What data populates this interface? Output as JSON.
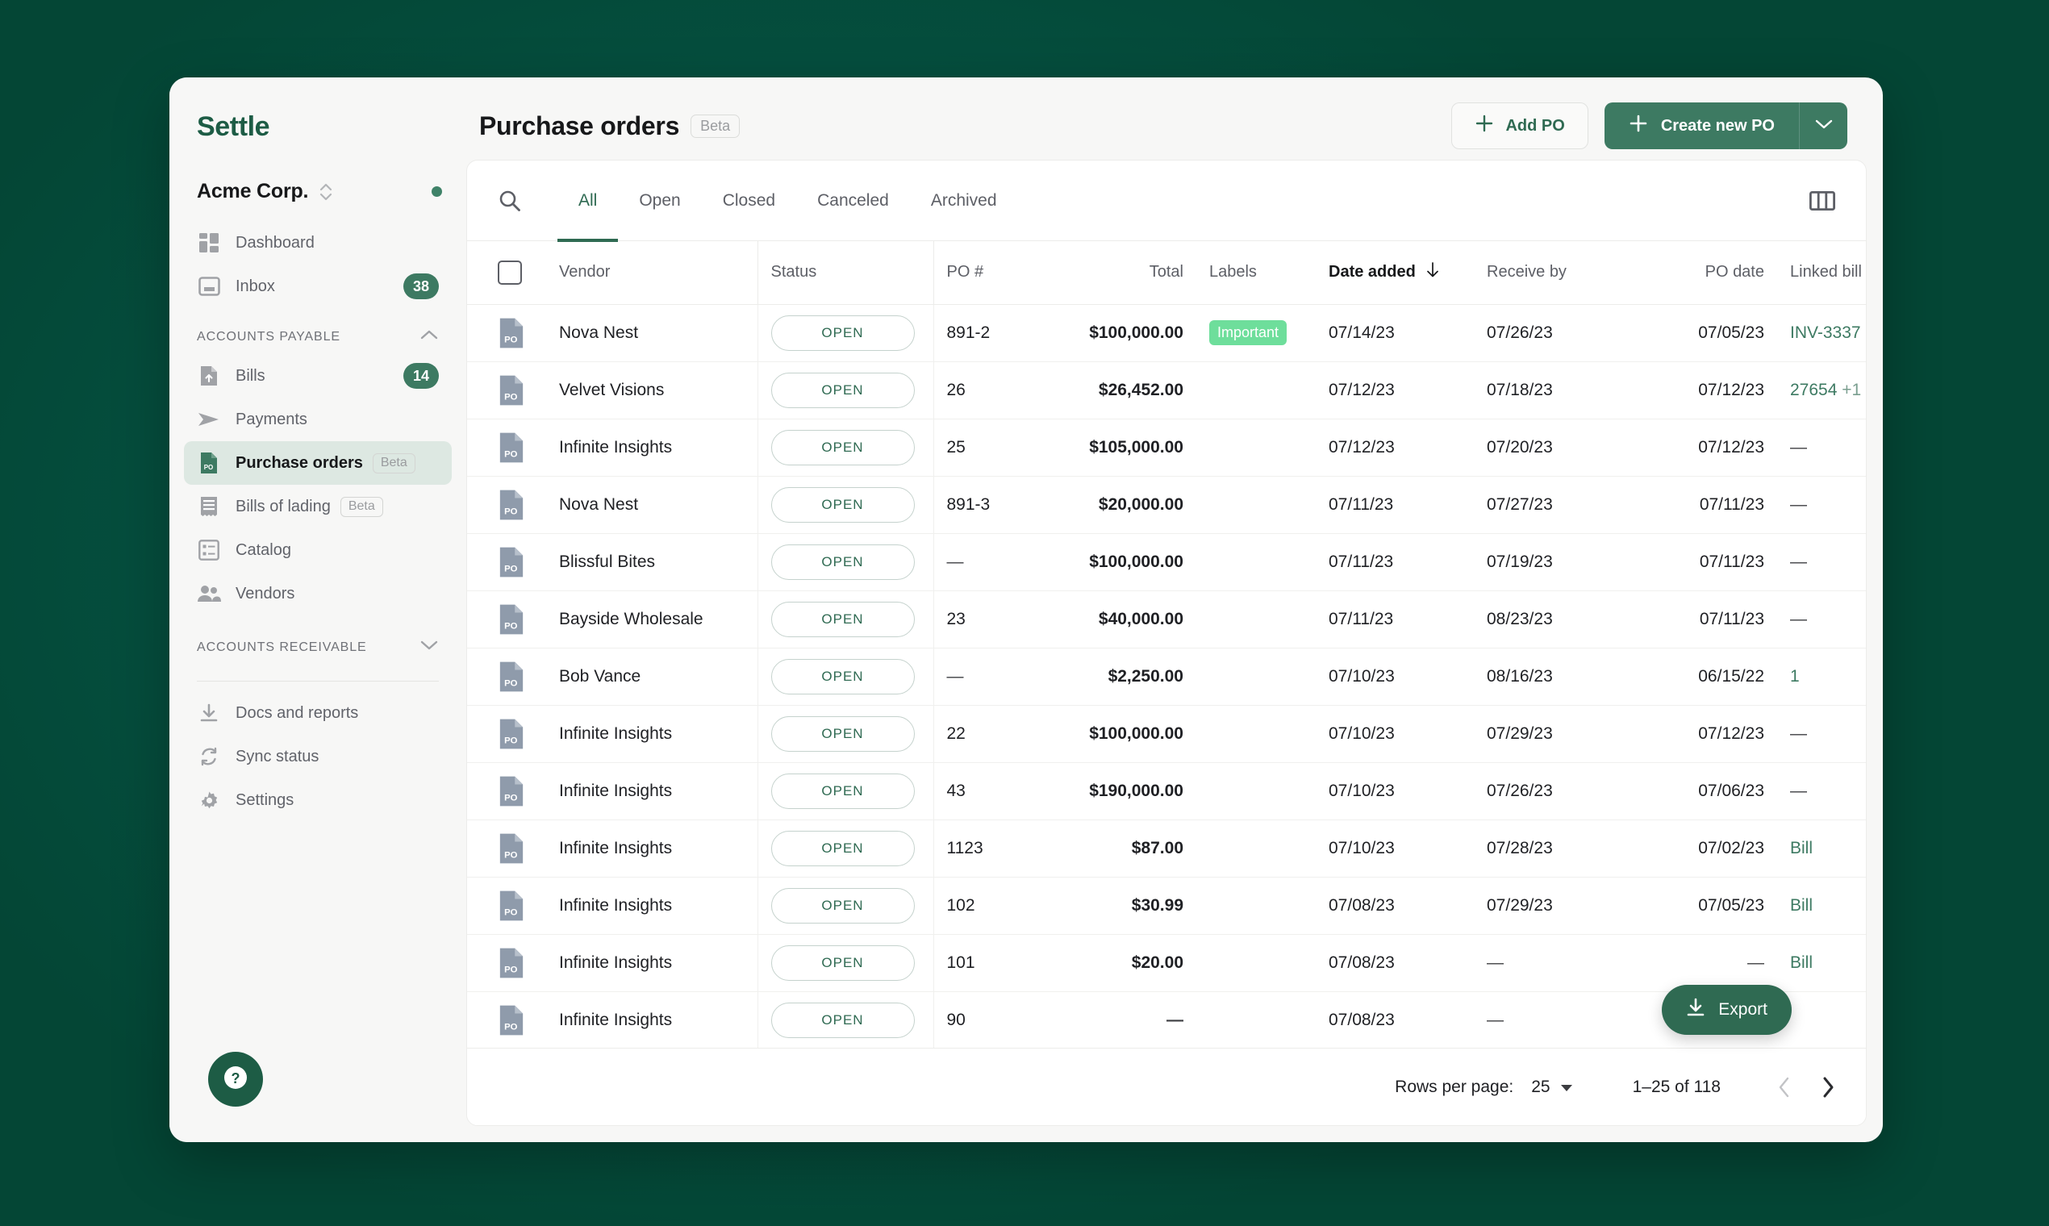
{
  "brand": "Settle",
  "org": {
    "name": "Acme Corp.",
    "status_dot_color": "#3f8268"
  },
  "sidebar": {
    "primary": [
      {
        "label": "Dashboard",
        "icon": "dashboard-icon",
        "badge": ""
      },
      {
        "label": "Inbox",
        "icon": "inbox-icon",
        "badge": "38"
      }
    ],
    "sections": [
      {
        "title": "ACCOUNTS PAYABLE",
        "expanded": true,
        "items": [
          {
            "label": "Bills",
            "icon": "bill-upload-icon",
            "badge": "14",
            "beta": ""
          },
          {
            "label": "Payments",
            "icon": "send-icon",
            "badge": "",
            "beta": ""
          },
          {
            "label": "Purchase orders",
            "icon": "po-doc-icon",
            "badge": "",
            "beta": "Beta",
            "active": true
          },
          {
            "label": "Bills of lading",
            "icon": "receipt-icon",
            "badge": "",
            "beta": "Beta"
          },
          {
            "label": "Catalog",
            "icon": "list-icon",
            "badge": "",
            "beta": ""
          },
          {
            "label": "Vendors",
            "icon": "people-icon",
            "badge": "",
            "beta": ""
          }
        ]
      },
      {
        "title": "ACCOUNTS RECEIVABLE",
        "expanded": false,
        "items": []
      }
    ],
    "footer_items": [
      {
        "label": "Docs and reports",
        "icon": "download-icon"
      },
      {
        "label": "Sync status",
        "icon": "sync-icon"
      },
      {
        "label": "Settings",
        "icon": "gear-icon"
      }
    ],
    "help_button": "help-icon"
  },
  "header": {
    "title": "Purchase orders",
    "beta_badge": "Beta",
    "add_po_label": "Add PO",
    "create_po_label": "Create new PO",
    "create_po_caret": "chevron-down-icon"
  },
  "toolbar": {
    "search_icon": "search-icon",
    "columns_icon": "columns-icon",
    "tabs": [
      {
        "label": "All",
        "active": true
      },
      {
        "label": "Open",
        "active": false
      },
      {
        "label": "Closed",
        "active": false
      },
      {
        "label": "Canceled",
        "active": false
      },
      {
        "label": "Archived",
        "active": false
      }
    ]
  },
  "table": {
    "columns": [
      {
        "key": "vendor",
        "label": "Vendor"
      },
      {
        "key": "status",
        "label": "Status"
      },
      {
        "key": "po",
        "label": "PO #"
      },
      {
        "key": "total",
        "label": "Total"
      },
      {
        "key": "labels",
        "label": "Labels"
      },
      {
        "key": "date_added",
        "label": "Date added",
        "sorted": true,
        "sort_dir": "desc",
        "sort_icon": "arrow-down-icon"
      },
      {
        "key": "receive_by",
        "label": "Receive by"
      },
      {
        "key": "po_date",
        "label": "PO date"
      },
      {
        "key": "linked_bill",
        "label": "Linked bill #"
      }
    ],
    "rows": [
      {
        "vendor": "Nova Nest",
        "status": "OPEN",
        "po": "891-2",
        "total": "$100,000.00",
        "label": "Important",
        "date_added": "07/14/23",
        "receive_by": "07/26/23",
        "po_date": "07/05/23",
        "linked_bill": "INV-3337",
        "linked_extra": ""
      },
      {
        "vendor": "Velvet Visions",
        "status": "OPEN",
        "po": "26",
        "total": "$26,452.00",
        "label": "",
        "date_added": "07/12/23",
        "receive_by": "07/18/23",
        "po_date": "07/12/23",
        "linked_bill": "27654",
        "linked_extra": "+1"
      },
      {
        "vendor": "Infinite Insights",
        "status": "OPEN",
        "po": "25",
        "total": "$105,000.00",
        "label": "",
        "date_added": "07/12/23",
        "receive_by": "07/20/23",
        "po_date": "07/12/23",
        "linked_bill": "—",
        "linked_extra": ""
      },
      {
        "vendor": "Nova Nest",
        "status": "OPEN",
        "po": "891-3",
        "total": "$20,000.00",
        "label": "",
        "date_added": "07/11/23",
        "receive_by": "07/27/23",
        "po_date": "07/11/23",
        "linked_bill": "—",
        "linked_extra": ""
      },
      {
        "vendor": "Blissful Bites",
        "status": "OPEN",
        "po": "—",
        "total": "$100,000.00",
        "label": "",
        "date_added": "07/11/23",
        "receive_by": "07/19/23",
        "po_date": "07/11/23",
        "linked_bill": "—",
        "linked_extra": ""
      },
      {
        "vendor": "Bayside Wholesale",
        "status": "OPEN",
        "po": "23",
        "total": "$40,000.00",
        "label": "",
        "date_added": "07/11/23",
        "receive_by": "08/23/23",
        "po_date": "07/11/23",
        "linked_bill": "—",
        "linked_extra": ""
      },
      {
        "vendor": "Bob Vance",
        "status": "OPEN",
        "po": "—",
        "total": "$2,250.00",
        "label": "",
        "date_added": "07/10/23",
        "receive_by": "08/16/23",
        "po_date": "06/15/22",
        "linked_bill": "1",
        "linked_extra": ""
      },
      {
        "vendor": "Infinite Insights",
        "status": "OPEN",
        "po": "22",
        "total": "$100,000.00",
        "label": "",
        "date_added": "07/10/23",
        "receive_by": "07/29/23",
        "po_date": "07/12/23",
        "linked_bill": "—",
        "linked_extra": ""
      },
      {
        "vendor": "Infinite Insights",
        "status": "OPEN",
        "po": "43",
        "total": "$190,000.00",
        "label": "",
        "date_added": "07/10/23",
        "receive_by": "07/26/23",
        "po_date": "07/06/23",
        "linked_bill": "—",
        "linked_extra": ""
      },
      {
        "vendor": "Infinite Insights",
        "status": "OPEN",
        "po": "1123",
        "total": "$87.00",
        "label": "",
        "date_added": "07/10/23",
        "receive_by": "07/28/23",
        "po_date": "07/02/23",
        "linked_bill": "Bill",
        "linked_extra": ""
      },
      {
        "vendor": "Infinite Insights",
        "status": "OPEN",
        "po": "102",
        "total": "$30.99",
        "label": "",
        "date_added": "07/08/23",
        "receive_by": "07/29/23",
        "po_date": "07/05/23",
        "linked_bill": "Bill",
        "linked_extra": ""
      },
      {
        "vendor": "Infinite Insights",
        "status": "OPEN",
        "po": "101",
        "total": "$20.00",
        "label": "",
        "date_added": "07/08/23",
        "receive_by": "—",
        "po_date": "—",
        "linked_bill": "Bill",
        "linked_extra": ""
      },
      {
        "vendor": "Infinite Insights",
        "status": "OPEN",
        "po": "90",
        "total": "—",
        "label": "",
        "date_added": "07/08/23",
        "receive_by": "—",
        "po_date": "—",
        "linked_bill": "",
        "linked_extra": ""
      }
    ]
  },
  "export": {
    "label": "Export",
    "icon": "download-icon"
  },
  "pagination": {
    "rows_per_page_label": "Rows per page:",
    "rows_per_page_value": "25",
    "range": "1–25 of 118",
    "prev_icon": "chevron-left-icon",
    "next_icon": "chevron-right-icon"
  },
  "colors": {
    "app_background": "#055141",
    "brand_green": "#1d5c45",
    "accent_green": "#3d7a62",
    "link_green": "#3d7a62",
    "label_important": "#6ede9b"
  }
}
